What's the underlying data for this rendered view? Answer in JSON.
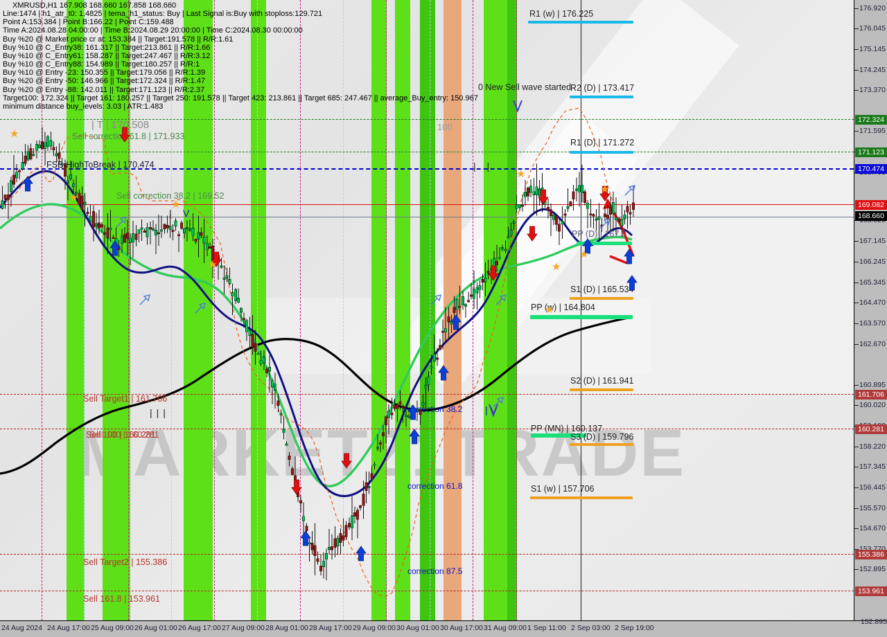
{
  "window": {
    "symbol_line": "XMRUSD,H1   167.908 168.660 167.858 168.660"
  },
  "header_lines": [
    "Line:1474 | h1_atr_t0: 1.4825 | tema_h1_status: Buy | Last Signal is:Buy with stoploss:129.721",
    "Point A:153.384 | Point B:166.22 | Point C:159.488",
    "Time A:2024.08.28 04:00:00 | Time B:2024.08.29 20:00:00 | Time C:2024.08.30 00:00:00",
    "Buy %20 @ Market price cr at: 153.384 || Target:191.578 || R/R:1.61",
    "Buy %10 @ C_Entry38: 161.317 || Target:213.861 || R/R:1.66",
    "Buy %10 @ C_Entry61: 158.287 || Target:247.467 || R/R:3.12",
    "Buy %10 @ C_Entry88: 154.989 || Target:180.257 || R/R:1",
    "Buy %10 @ Entry -23: 150.355 || Target:179.056 || R/R:1.39",
    "Buy %20 @ Entry -50: 146.966 || Target:172.324 || R/R:1.47",
    "Buy %20 @ Entry -88: 142.011 || Target:171.123 || R/R:2.37",
    "Target100: 172.324 || Target 161: 180.257 || Target 250: 191.578 || Target 423: 213.861 || Target 685: 247.467 || average_Buy_entry: 150.967",
    "minimum distance buy_levels: 3.03 | ATR:1.483"
  ],
  "chart_data": {
    "type": "line",
    "title": "XMRUSD,H1",
    "timeframe": "H1",
    "ohlc": {
      "open": 167.908,
      "high": 168.66,
      "low": 167.858,
      "close": 168.66
    },
    "ylim": [
      152.895,
      176.92
    ],
    "y_ticks": [
      "176.920",
      "176.045",
      "175.145",
      "174.245",
      "173.370",
      "171.595",
      "170.695",
      "169.795",
      "169.920",
      "168.020",
      "167.145",
      "166.245",
      "165.345",
      "164.470",
      "163.570",
      "162.670",
      "160.895",
      "160.020",
      "159.120",
      "158.220",
      "157.345",
      "156.445",
      "155.570",
      "154.670",
      "153.770",
      "152.895"
    ],
    "y_badges": [
      {
        "value": "172.324",
        "color": "#1a7a1a"
      },
      {
        "value": "171.123",
        "color": "#1a7a1a"
      },
      {
        "value": "170.474",
        "color": "#0b0bd8"
      },
      {
        "value": "169.082",
        "color": "#e01010"
      },
      {
        "value": "168.660",
        "color": "#000000"
      },
      {
        "value": "161.706",
        "color": "#b03a3a"
      },
      {
        "value": "160.281",
        "color": "#b03a3a"
      },
      {
        "value": "155.386",
        "color": "#b03a3a"
      },
      {
        "value": "153.961",
        "color": "#b03a3a"
      }
    ],
    "x_ticks": [
      "24 Aug 2024",
      "24 Aug 17:00",
      "25 Aug 09:00",
      "26 Aug 01:00",
      "26 Aug 17:00",
      "27 Aug 09:00",
      "28 Aug 01:00",
      "28 Aug 17:00",
      "29 Aug 09:00",
      "30 Aug 01:00",
      "30 Aug 17:00",
      "31 Aug 09:00",
      "1 Sep 11:00",
      "2 Sep 03:00",
      "2 Sep 19:00"
    ],
    "pivot_levels": [
      {
        "label": "R1 (w) | 176.225",
        "value": 176.225,
        "color": "#18b8e8"
      },
      {
        "label": "R2 (D) | 173.417",
        "value": 173.417,
        "color": "#18b8e8"
      },
      {
        "label": "R1 (D) | 171.272",
        "value": 171.272,
        "color": "#18b8e8"
      },
      {
        "label": "PP (D) | 167.0",
        "value": 167.0,
        "color": "#19e07a"
      },
      {
        "label": "S1 (D) | 165.534",
        "value": 165.534,
        "color": "#f0a020"
      },
      {
        "label": "PP (w) | 164.804",
        "value": 164.804,
        "color": "#19e07a"
      },
      {
        "label": "S2 (D) | 161.941",
        "value": 161.941,
        "color": "#f0a020"
      },
      {
        "label": "PP (MN) | 160.137",
        "value": 160.137,
        "color": "#19e07a"
      },
      {
        "label": "S3 (D) | 159.796",
        "value": 159.796,
        "color": "#f0a020"
      },
      {
        "label": "S1 (w) | 157.706",
        "value": 157.706,
        "color": "#f0a020"
      }
    ],
    "annotations": [
      {
        "text": "| T | 170.508",
        "value": 170.508,
        "color": "#8a8a8a"
      },
      {
        "text": "Sell correction 61.8 | 171.933",
        "value": 171.933,
        "color": "#6b8f6b"
      },
      {
        "text": "FSB-HighToBreak | 170.474",
        "value": 170.474,
        "color": "#1a1a3a"
      },
      {
        "text": "Sell correction 38.2 | 169.52",
        "value": 169.52,
        "color": "#6b8f6b"
      },
      {
        "text": "Sell Target1 | 161.706",
        "value": 161.706,
        "color": "#b5352c"
      },
      {
        "text": "Sell 100 | 160.281",
        "value": 160.281,
        "color": "#b5352c"
      },
      {
        "text": "Sell Target2 | 155.386",
        "value": 155.386,
        "color": "#b5352c"
      },
      {
        "text": "Sell 161.8 | 153.961",
        "value": 153.961,
        "color": "#b5352c"
      },
      {
        "text": "0 New Sell wave started",
        "color": "#1a1a1a"
      },
      {
        "text": "100",
        "color": "#9a9a9a"
      },
      {
        "text": "correction 38.2",
        "color": "#1010c8"
      },
      {
        "text": "correction 61.8",
        "color": "#1010c8"
      },
      {
        "text": "correction 87.5",
        "color": "#1010c8"
      }
    ],
    "watermark": "MARKETZ1TRADE"
  }
}
